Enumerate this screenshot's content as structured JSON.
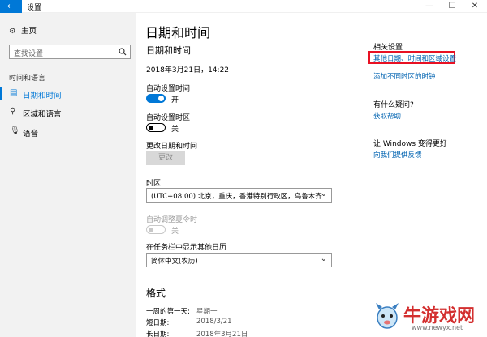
{
  "window": {
    "title": "设置",
    "back_glyph": "←",
    "min_glyph": "—",
    "max_glyph": "☐",
    "close_glyph": "✕"
  },
  "sidebar": {
    "home": "主页",
    "search_placeholder": "查找设置",
    "section": "时间和语言",
    "items": [
      {
        "label": "日期和时间",
        "icon": "calendar-clock-icon",
        "active": true
      },
      {
        "label": "区域和语言",
        "icon": "region-language-icon",
        "active": false
      },
      {
        "label": "语音",
        "icon": "microphone-icon",
        "active": false
      }
    ]
  },
  "main": {
    "title": "日期和时间",
    "subtitle": "日期和时间",
    "datetime": "2018年3月21日，14:22",
    "auto_time": {
      "label": "自动设置时间",
      "state": "开"
    },
    "auto_zone": {
      "label": "自动设置时区",
      "state": "关"
    },
    "change_label": "更改日期和时间",
    "change_button": "更改",
    "timezone": {
      "label": "时区",
      "value": "(UTC+08:00) 北京，重庆，香港特别行政区，乌鲁木齐"
    },
    "dst": {
      "label": "自动调整夏令时",
      "state": "关"
    },
    "extra_cal": {
      "label": "在任务栏中显示其他日历",
      "value": "简体中文(农历)"
    },
    "formats": {
      "title": "格式",
      "rows": [
        {
          "k": "一周的第一天:",
          "v": "星期一"
        },
        {
          "k": "短日期:",
          "v": "2018/3/21"
        },
        {
          "k": "长日期:",
          "v": "2018年3月21日"
        }
      ]
    }
  },
  "right": {
    "related_title": "相关设置",
    "link1": "其他日期、时间和区域设置",
    "link2": "添加不同时区的时钟",
    "question_title": "有什么疑问?",
    "help_link": "获取帮助",
    "improve_title": "让 Windows 变得更好",
    "feedback_link": "向我们提供反馈"
  },
  "watermark": {
    "text": "牛游戏网",
    "url": "www.newyx.net"
  }
}
